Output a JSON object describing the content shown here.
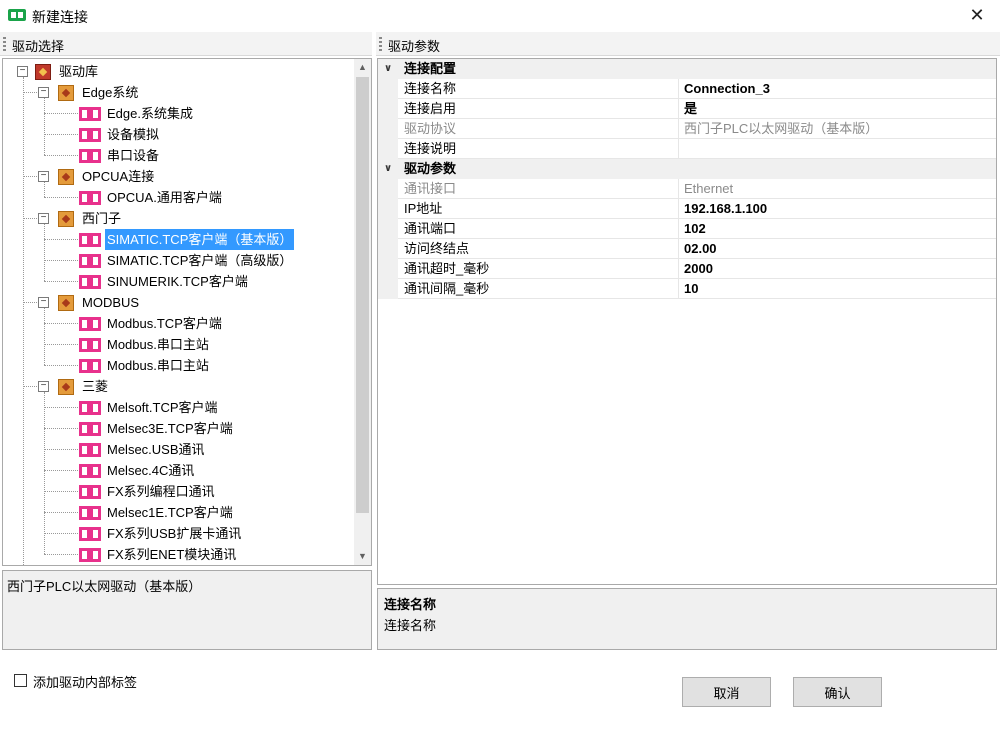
{
  "window": {
    "title": "新建连接",
    "close_symbol": "✕"
  },
  "left_panel": {
    "header": "驱动选择",
    "tree": [
      {
        "label": "驱动库",
        "icon": "root",
        "expander": "−"
      },
      {
        "label": "Edge系统",
        "icon": "folder",
        "expander": "−"
      },
      {
        "label": "Edge.系统集成",
        "icon": "driver"
      },
      {
        "label": "设备模拟",
        "icon": "driver"
      },
      {
        "label": "串口设备",
        "icon": "driver"
      },
      {
        "label": "OPCUA连接",
        "icon": "folder",
        "expander": "−"
      },
      {
        "label": "OPCUA.通用客户端",
        "icon": "driver"
      },
      {
        "label": "西门子",
        "icon": "folder",
        "expander": "−"
      },
      {
        "label": "SIMATIC.TCP客户端（基本版）",
        "icon": "driver",
        "selected": true
      },
      {
        "label": "SIMATIC.TCP客户端（高级版）",
        "icon": "driver"
      },
      {
        "label": "SINUMERIK.TCP客户端",
        "icon": "driver"
      },
      {
        "label": "MODBUS",
        "icon": "folder",
        "expander": "−"
      },
      {
        "label": "Modbus.TCP客户端",
        "icon": "driver"
      },
      {
        "label": "Modbus.串口主站",
        "icon": "driver"
      },
      {
        "label": "Modbus.串口主站",
        "icon": "driver"
      },
      {
        "label": "三菱",
        "icon": "folder",
        "expander": "−"
      },
      {
        "label": "Melsoft.TCP客户端",
        "icon": "driver"
      },
      {
        "label": "Melsec3E.TCP客户端",
        "icon": "driver"
      },
      {
        "label": "Melsec.USB通讯",
        "icon": "driver"
      },
      {
        "label": "Melsec.4C通讯",
        "icon": "driver"
      },
      {
        "label": "FX系列编程口通讯",
        "icon": "driver"
      },
      {
        "label": "Melsec1E.TCP客户端",
        "icon": "driver"
      },
      {
        "label": "FX系列USB扩展卡通讯",
        "icon": "driver"
      },
      {
        "label": "FX系列ENET模块通讯",
        "icon": "driver"
      }
    ],
    "scroll_up": "▲",
    "scroll_down": "▼",
    "description": "西门子PLC以太网驱动（基本版）"
  },
  "right_panel": {
    "header": "驱动参数",
    "categories": [
      {
        "name": "连接配置",
        "arrow": "∨",
        "properties": [
          {
            "name": "连接名称",
            "value": "Connection_3",
            "readonly": false
          },
          {
            "name": "连接启用",
            "value": "是",
            "readonly": false
          },
          {
            "name": "驱动协议",
            "value": "西门子PLC以太网驱动（基本版）",
            "readonly": true
          },
          {
            "name": "连接说明",
            "value": "",
            "readonly": false
          }
        ]
      },
      {
        "name": "驱动参数",
        "arrow": "∨",
        "properties": [
          {
            "name": "通讯接口",
            "value": "Ethernet",
            "readonly": true
          },
          {
            "name": "IP地址",
            "value": "192.168.1.100",
            "readonly": false
          },
          {
            "name": "通讯端口",
            "value": "102",
            "readonly": false
          },
          {
            "name": "访问终结点",
            "value": "02.00",
            "readonly": false
          },
          {
            "name": "通讯超时_毫秒",
            "value": "2000",
            "readonly": false
          },
          {
            "name": "通讯间隔_毫秒",
            "value": "10",
            "readonly": false
          }
        ]
      }
    ],
    "description": {
      "title": "连接名称",
      "body": "连接名称"
    }
  },
  "footer": {
    "checkbox_label": "添加驱动内部标签",
    "checkbox_checked": false,
    "cancel_label": "取消",
    "ok_label": "确认"
  }
}
